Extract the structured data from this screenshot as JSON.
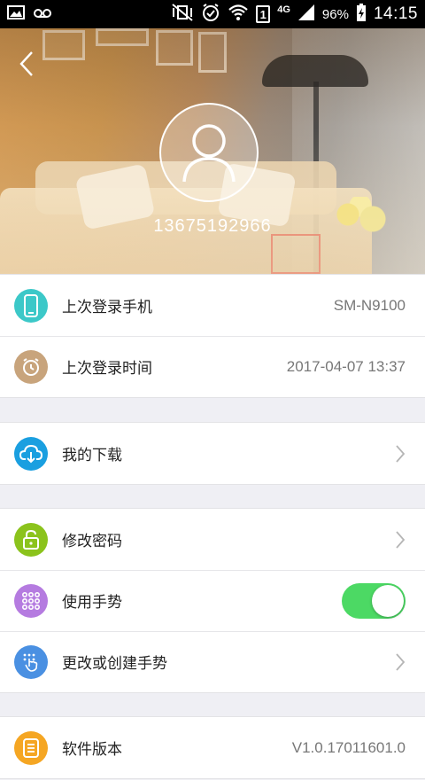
{
  "status_bar": {
    "network": "4G",
    "sim": "1",
    "battery_percent": "96%",
    "time": "14:15"
  },
  "profile": {
    "phone": "13675192966"
  },
  "login_info": {
    "last_device_label": "上次登录手机",
    "last_device_value": "SM-N9100",
    "last_time_label": "上次登录时间",
    "last_time_value": "2017-04-07 13:37"
  },
  "downloads": {
    "label": "我的下载"
  },
  "security": {
    "change_password_label": "修改密码",
    "use_gesture_label": "使用手势",
    "use_gesture_enabled": true,
    "create_gesture_label": "更改或创建手势"
  },
  "version": {
    "label": "软件版本",
    "value": "V1.0.17011601.0"
  },
  "colors": {
    "device_icon": "#3cc8c8",
    "time_icon": "#c8a47c",
    "download_icon": "#1a9fe0",
    "password_icon": "#8bc31c",
    "gesture_icon": "#b57be0",
    "create_gesture_icon": "#4a90e2",
    "version_icon": "#f5a623",
    "toggle_on": "#4cd964"
  }
}
